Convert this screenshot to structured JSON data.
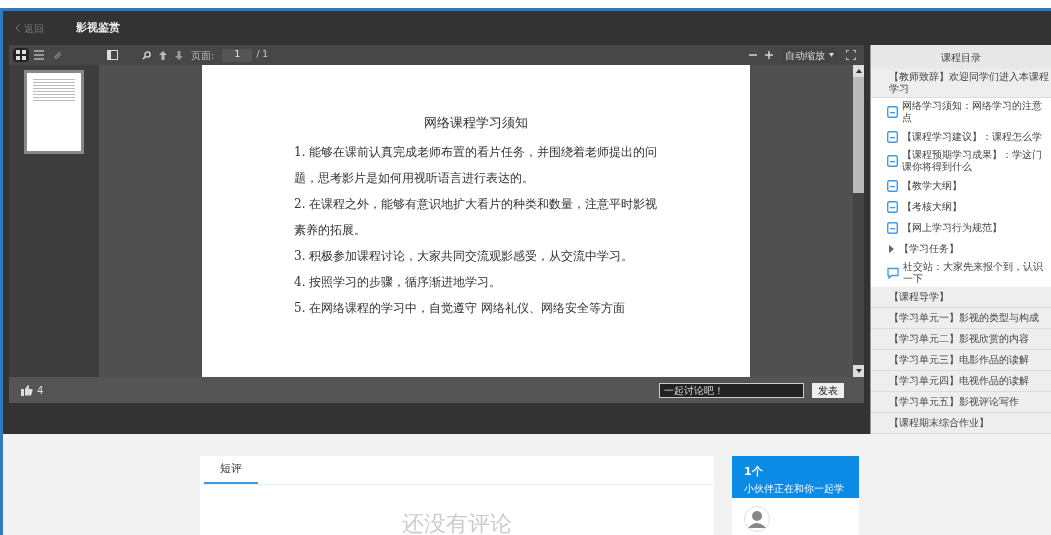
{
  "header": {
    "back": "返回",
    "title": "影视鉴赏"
  },
  "viewer": {
    "tools": [
      {
        "kind": "grid",
        "selected": true
      },
      {
        "kind": "list",
        "selected": false
      },
      {
        "kind": "clip",
        "selected": false
      }
    ],
    "page_label": "页面:",
    "page_value": "1",
    "page_total": "/ 1",
    "zoom": "自动缩放",
    "thumbnails": [
      {
        "selected": true
      }
    ],
    "document": {
      "title": "网络课程学习须知",
      "paragraphs": [
        "1. 能够在课前认真完成老师布置的看片任务，并围绕着老师提出的问题，思考影片是如何用视听语言进行表达的。",
        "2. 在课程之外，能够有意识地扩大看片的种类和数量，注意平时影视素养的拓展。",
        "3. 积极参加课程讨论，大家共同交流观影感受，从交流中学习。",
        "4. 按照学习的步骤，循序渐进地学习。",
        "5. 在网络课程的学习中，自觉遵守 网络礼仪、网络安全等方面"
      ]
    },
    "likes": "4",
    "discuss_placeholder": "一起讨论吧！",
    "send": "发表"
  },
  "catalog": {
    "title": "课程目录",
    "items": [
      {
        "kind": "notice",
        "label": "【教师致辞】欢迎同学们进入本课程学习"
      },
      {
        "kind": "doc",
        "label": "网络学习须知：网络学习的注意点"
      },
      {
        "kind": "doc",
        "label": "【课程学习建议】：课程怎么学"
      },
      {
        "kind": "doc",
        "label": "【课程预期学习成果】：学这门课你将得到什么"
      },
      {
        "kind": "doc",
        "label": "【教学大纲】"
      },
      {
        "kind": "doc",
        "label": "【考核大纲】"
      },
      {
        "kind": "doc",
        "label": "【网上学习行为规范】"
      },
      {
        "kind": "folder",
        "label": "【学习任务】",
        "expanded": false
      },
      {
        "kind": "chat",
        "label": "社交站：大家先来报个到，认识一下"
      },
      {
        "kind": "section",
        "label": "【课程导学】"
      },
      {
        "kind": "section",
        "label": "【学习单元一】影视的类型与构成"
      },
      {
        "kind": "section",
        "label": "【学习单元二】影视欣赏的内容"
      },
      {
        "kind": "section",
        "label": "【学习单元三】电影作品的读解"
      },
      {
        "kind": "section",
        "label": "【学习单元四】电视作品的读解"
      },
      {
        "kind": "section",
        "label": "【学习单元五】影视评论写作"
      },
      {
        "kind": "section",
        "label": "【课程期末综合作业】"
      }
    ]
  },
  "comments": {
    "tabs": [
      {
        "label": "短评",
        "selected": true
      }
    ],
    "empty": "还没有评论"
  },
  "peers": {
    "count": "1个",
    "text": "小伙伴正在和你一起学"
  }
}
